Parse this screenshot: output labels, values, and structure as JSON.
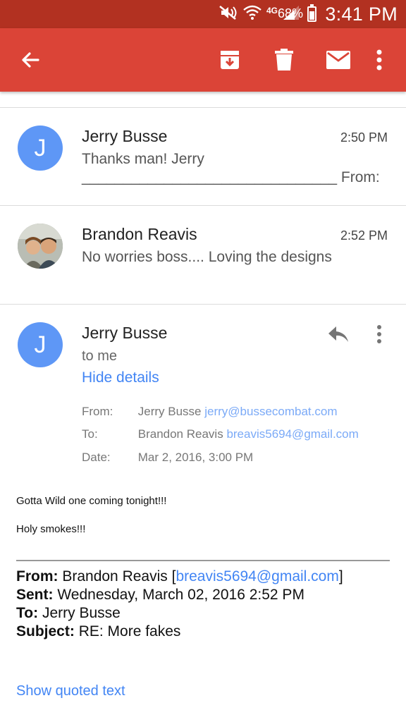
{
  "status_bar": {
    "network": "4G",
    "battery": "68%",
    "time": "3:41 PM"
  },
  "app_bar": {
    "icons": [
      "back-arrow-icon",
      "archive-icon",
      "delete-icon",
      "mark-unread-icon",
      "more-vert-icon"
    ]
  },
  "colors": {
    "status_bar": "#b23121",
    "app_bar": "#db4437",
    "avatar": "#5e97f6",
    "link": "#4285f4"
  },
  "messages": [
    {
      "initial": "J",
      "sender": "Jerry Busse",
      "time": "2:50 PM",
      "snippet_line1": "Thanks man! Jerry",
      "snippet_line2": "_______________________________ From:"
    },
    {
      "sender": "Brandon Reavis",
      "time": "2:52 PM",
      "snippet_line1": "No worries boss.... Loving the designs"
    }
  ],
  "open_message": {
    "initial": "J",
    "sender": "Jerry Busse",
    "recipient": "to me",
    "hide_details": "Hide details",
    "details": {
      "from_label": "From:",
      "from_name": "Jerry Busse",
      "from_email": "jerry@bussecombat.com",
      "to_label": "To:",
      "to_name": "Brandon Reavis",
      "to_email": "breavis5694@gmail.com",
      "date_label": "Date:",
      "date_value": "Mar 2, 2016, 3:00 PM"
    },
    "body_line1": "Gotta Wild one coming tonight!!!",
    "body_line2": "Holy smokes!!!",
    "quoted_header": {
      "from_label": "From:",
      "from_name": "Brandon Reavis [",
      "from_email": "breavis5694@gmail.com",
      "from_close": "]",
      "sent_label": "Sent:",
      "sent_value": "Wednesday, March 02, 2016 2:52 PM",
      "to_label": "To:",
      "to_value": "Jerry Busse",
      "subject_label": "Subject:",
      "subject_value": "RE: More fakes"
    },
    "show_quoted": "Show quoted text"
  }
}
